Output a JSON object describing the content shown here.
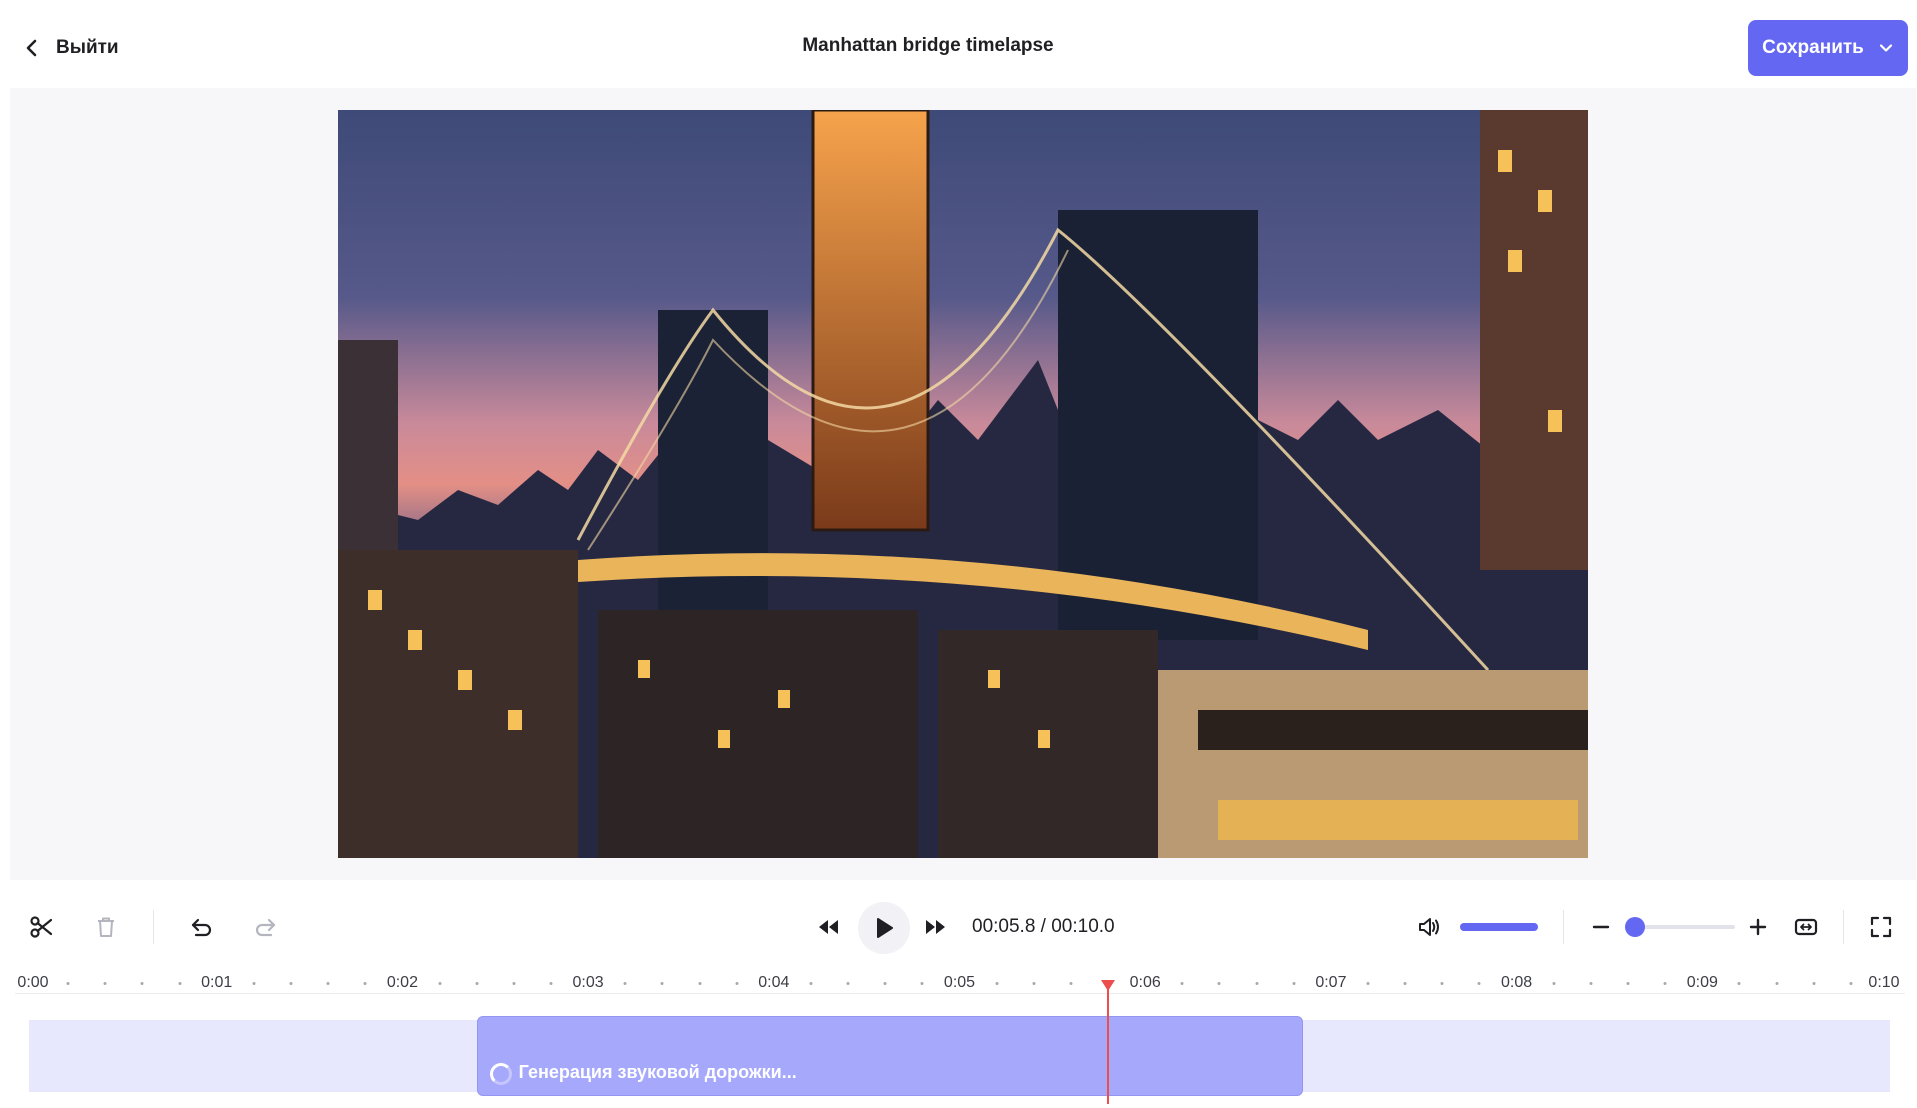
{
  "header": {
    "back_label": "Выйти",
    "title": "Manhattan bridge timelapse",
    "save_label": "Сохранить"
  },
  "player": {
    "timecode": "00:05.8 / 00:10.0",
    "current_seconds": 5.8,
    "duration_seconds": 10.0,
    "volume": 1.0,
    "zoom_level": 0.0
  },
  "timeline": {
    "ruler_labels": [
      "0:00",
      "0:01",
      "0:02",
      "0:03",
      "0:04",
      "0:05",
      "0:06",
      "0:07",
      "0:08",
      "0:09",
      "0:10"
    ],
    "segment": {
      "label": "Генерация звуковой дорожки...",
      "start_seconds": 2.4,
      "end_seconds": 6.85
    }
  },
  "colors": {
    "accent": "#6467f2",
    "track_bg": "#e7e7fe",
    "segment": "#a6a8fb",
    "playhead": "#ec4e4e"
  },
  "icons": {
    "back": "chevron-left-icon",
    "save_menu": "chevron-down-icon",
    "cut": "scissors-icon",
    "delete": "trash-icon",
    "undo": "undo-icon",
    "redo": "redo-icon",
    "rewind": "rewind-icon",
    "play": "play-icon",
    "forward": "fast-forward-icon",
    "volume": "speaker-icon",
    "zoom_out": "minus-icon",
    "zoom_in": "plus-icon",
    "fit": "fit-width-icon",
    "fullscreen": "fullscreen-icon"
  }
}
